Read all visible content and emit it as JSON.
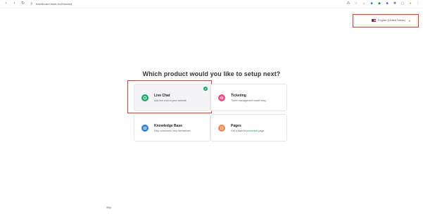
{
  "browser": {
    "back_glyph": "‹",
    "forward_glyph": "›",
    "reload_glyph": "↻",
    "site_glyph": "⚲",
    "url": "dashboard.tawk.to/#/wizard",
    "extensions": [
      {
        "icon": "translate-icon",
        "glyph": "⁂",
        "color": "#777777"
      },
      {
        "icon": "star-icon",
        "glyph": "☆",
        "color": "#777777"
      },
      {
        "icon": "extension-icon",
        "glyph": "⌂",
        "color": "#777777"
      },
      {
        "icon": "ext-blue-icon",
        "glyph": "■",
        "color": "#1a73e8"
      },
      {
        "icon": "ext-green-icon",
        "glyph": "◆",
        "color": "#1e8e3e"
      },
      {
        "icon": "ext-purple-icon",
        "glyph": "■",
        "color": "#6c3ce2"
      },
      {
        "icon": "puzzle-icon",
        "glyph": "✱",
        "color": "#777777"
      },
      {
        "icon": "window-icon",
        "glyph": "▢",
        "color": "#777777"
      },
      {
        "icon": "profile-icon",
        "glyph": "●",
        "color": "#f2a51a"
      },
      {
        "icon": "menu-icon",
        "glyph": "⋮",
        "color": "#777777"
      }
    ]
  },
  "language": {
    "label": "English (United States)",
    "caret": "▾"
  },
  "heading": "Which product would you like to setup next?",
  "products": [
    {
      "title": "Live Chat",
      "description": "Add live chat to your website",
      "icon": "chat-bubble-icon",
      "icon_color": "#19a868",
      "selected": true
    },
    {
      "title": "Ticketing",
      "description": "Ticket management made easy",
      "icon": "ticket-icon",
      "icon_color": "#e8508a",
      "selected": false
    },
    {
      "title": "Knowledge Base",
      "description": "Help customers help themselves",
      "icon": "book-icon",
      "icon_color": "#2b7fd4",
      "selected": false
    },
    {
      "title": "Pages",
      "description_prefix": "Get a tawk.to/",
      "description_link": "yourbrand",
      "description_suffix": " page",
      "icon": "pages-icon",
      "icon_color": "#f08a4b",
      "selected": false
    }
  ],
  "footer": {
    "text": "Skip"
  },
  "colors": {
    "accent_green": "#19a868",
    "highlight_red": "#e53935"
  }
}
